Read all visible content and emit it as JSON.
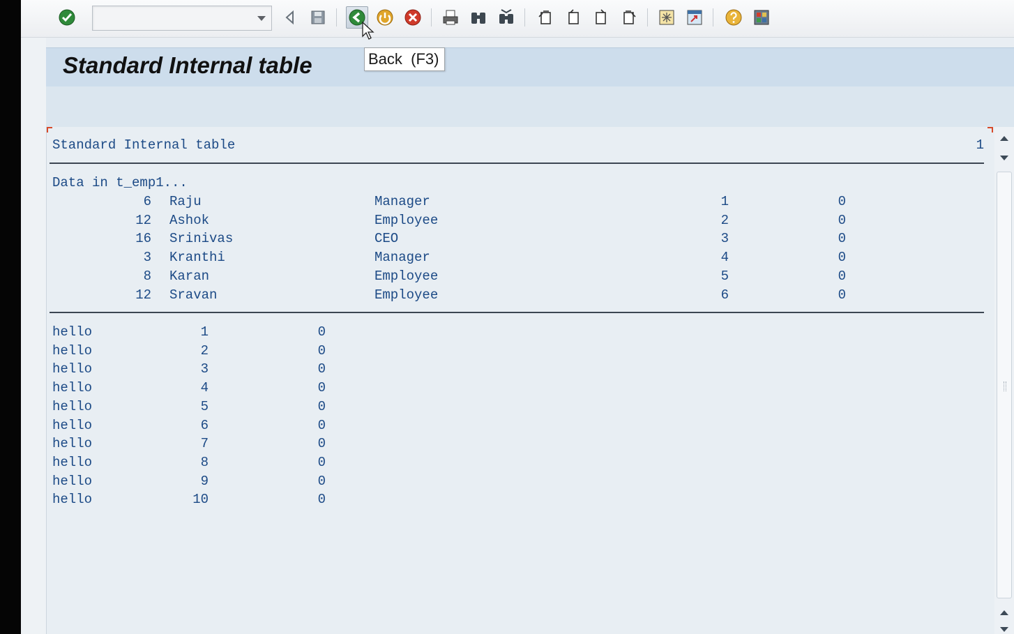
{
  "toolbar": {
    "command_field": {
      "value": "",
      "placeholder": ""
    },
    "icons": [
      "enter-checkmark-icon",
      "save-icon",
      "back-icon",
      "exit-icon",
      "cancel-icon",
      "print-icon",
      "find-icon",
      "find-next-icon",
      "first-page-icon",
      "previous-page-icon",
      "next-page-icon",
      "last-page-icon",
      "create-session-icon",
      "shortcut-icon",
      "help-icon",
      "customize-layout-icon"
    ]
  },
  "tooltip": {
    "text": "Back  (F3)"
  },
  "page": {
    "title": "Standard Internal table"
  },
  "list": {
    "heading": "Standard Internal table",
    "page_number": "1",
    "intro": "Data in t_emp1...",
    "employees": [
      {
        "id": "6",
        "name": "Raju",
        "role": "Manager",
        "seq": "1",
        "val": "0"
      },
      {
        "id": "12",
        "name": "Ashok",
        "role": "Employee",
        "seq": "2",
        "val": "0"
      },
      {
        "id": "16",
        "name": "Srinivas",
        "role": "CEO",
        "seq": "3",
        "val": "0"
      },
      {
        "id": "3",
        "name": "Kranthi",
        "role": "Manager",
        "seq": "4",
        "val": "0"
      },
      {
        "id": "8",
        "name": "Karan",
        "role": "Employee",
        "seq": "5",
        "val": "0"
      },
      {
        "id": "12",
        "name": "Sravan",
        "role": "Employee",
        "seq": "6",
        "val": "0"
      }
    ],
    "hello_rows": [
      {
        "text": "hello",
        "num": "1",
        "zero": "0"
      },
      {
        "text": "hello",
        "num": "2",
        "zero": "0"
      },
      {
        "text": "hello",
        "num": "3",
        "zero": "0"
      },
      {
        "text": "hello",
        "num": "4",
        "zero": "0"
      },
      {
        "text": "hello",
        "num": "5",
        "zero": "0"
      },
      {
        "text": "hello",
        "num": "6",
        "zero": "0"
      },
      {
        "text": "hello",
        "num": "7",
        "zero": "0"
      },
      {
        "text": "hello",
        "num": "8",
        "zero": "0"
      },
      {
        "text": "hello",
        "num": "9",
        "zero": "0"
      },
      {
        "text": "hello",
        "num": "10",
        "zero": "0"
      }
    ]
  },
  "colors": {
    "list_text": "#1c4a86",
    "title_band": "#cdddec",
    "background": "#e8eef3"
  }
}
